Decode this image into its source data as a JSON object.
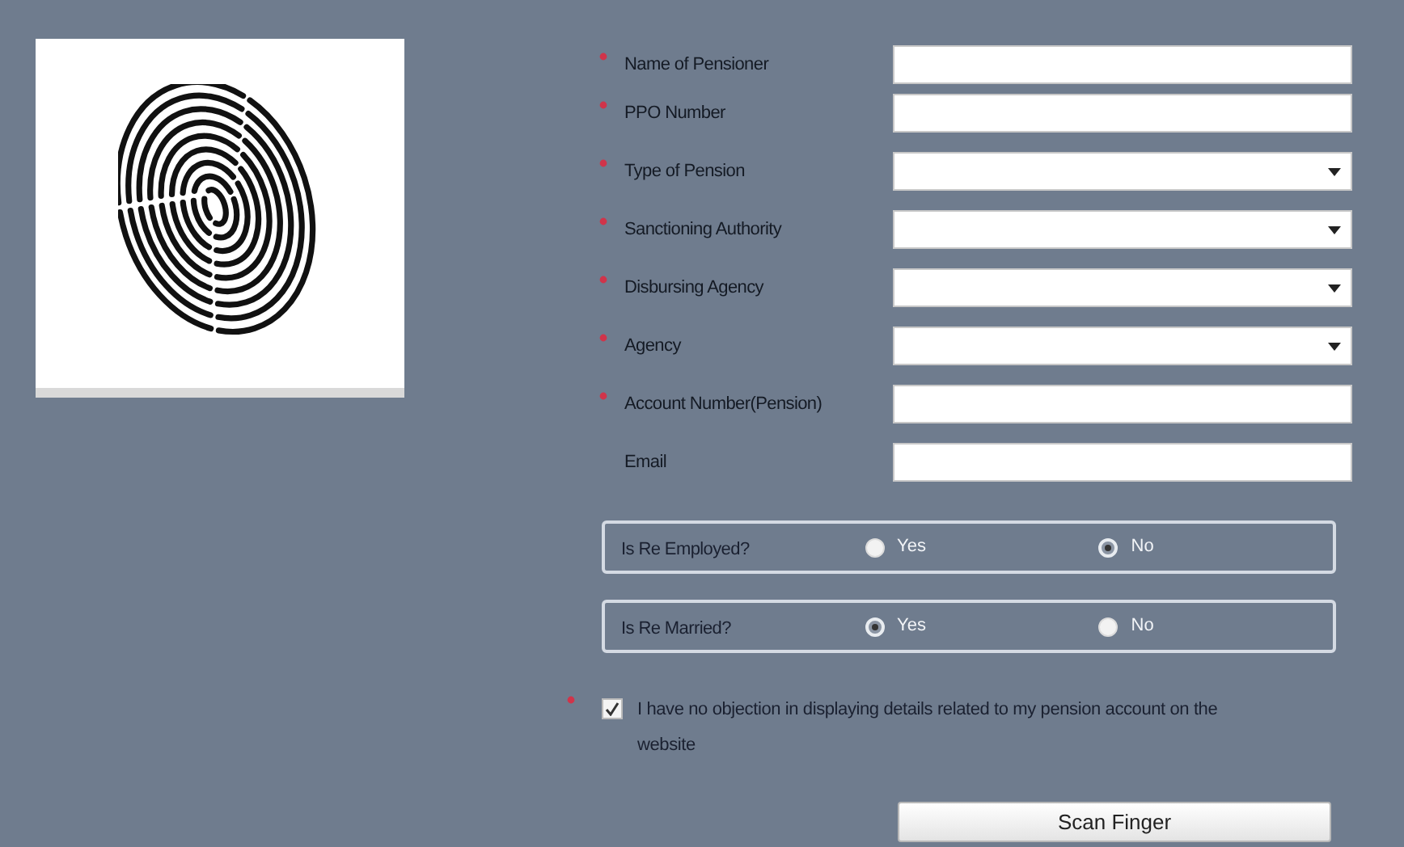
{
  "fields": [
    {
      "kind": "text",
      "label": "Name of Pensioner",
      "required": true
    },
    {
      "kind": "text",
      "label": "PPO Number",
      "required": true
    },
    {
      "kind": "dropdown",
      "label": "Type of Pension",
      "required": true
    },
    {
      "kind": "dropdown",
      "label": "Sanctioning Authority",
      "required": true
    },
    {
      "kind": "dropdown",
      "label": "Disbursing Agency",
      "required": true
    },
    {
      "kind": "dropdown",
      "label": "Agency",
      "required": true
    },
    {
      "kind": "text",
      "label": "Account Number(Pension)",
      "required": true
    },
    {
      "kind": "text",
      "label": "Email",
      "required": false
    }
  ],
  "radio_groups": [
    {
      "label": "Is Re Employed?",
      "options": [
        {
          "label": "Yes",
          "selected": false
        },
        {
          "label": "No",
          "selected": true
        }
      ]
    },
    {
      "label": "Is Re Married?",
      "options": [
        {
          "label": "Yes",
          "selected": true
        },
        {
          "label": "No",
          "selected": false
        }
      ]
    }
  ],
  "consent": {
    "label": "I have no objection in displaying details related to my pension account on the website",
    "checked": true,
    "required": true
  },
  "button": {
    "label": "Scan Finger"
  }
}
